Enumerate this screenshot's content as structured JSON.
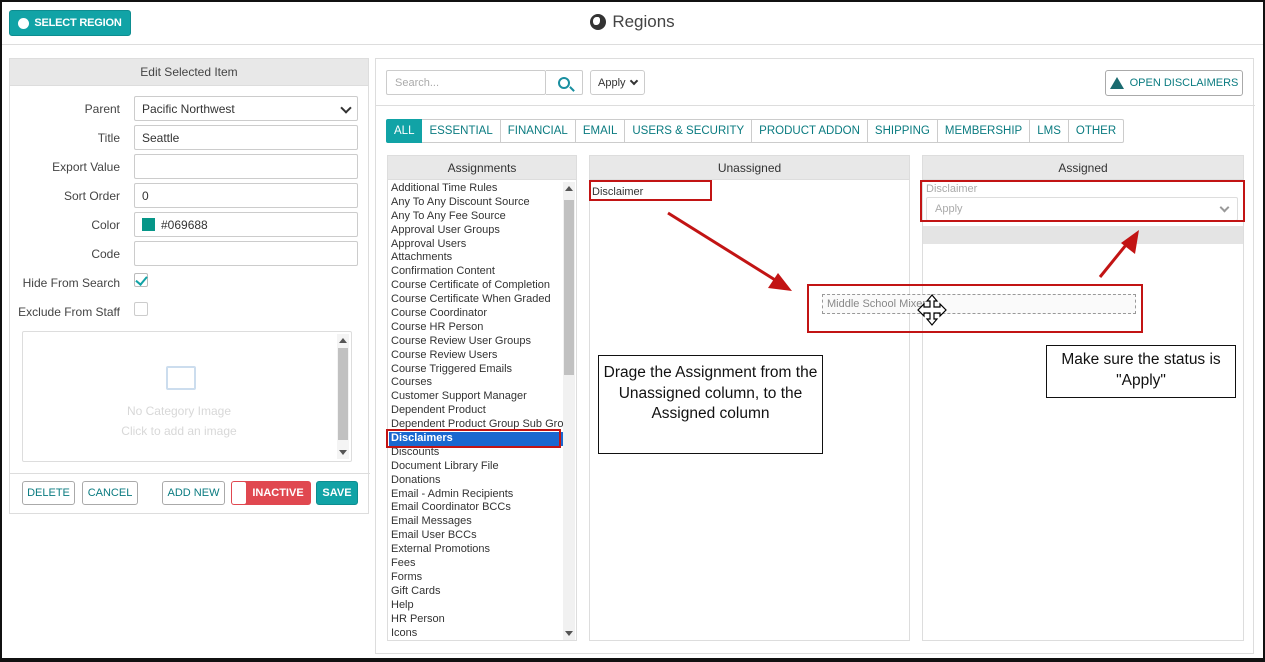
{
  "header": {
    "select_region_label": "SELECT REGION",
    "title": "Regions"
  },
  "edit_panel": {
    "title": "Edit Selected Item",
    "fields": {
      "parent": {
        "label": "Parent",
        "value": "Pacific Northwest"
      },
      "title": {
        "label": "Title",
        "value": "Seattle"
      },
      "export_value": {
        "label": "Export Value",
        "value": ""
      },
      "sort_order": {
        "label": "Sort Order",
        "value": "0"
      },
      "color": {
        "label": "Color",
        "value": "#069688",
        "swatch": "#069688"
      },
      "code": {
        "label": "Code",
        "value": ""
      },
      "hide_from_search": {
        "label": "Hide From Search",
        "checked": true
      },
      "exclude_from_staff": {
        "label": "Exclude From Staff",
        "checked": false
      }
    },
    "image": {
      "line1": "No Category Image",
      "line2": "Click to add an image"
    },
    "buttons": {
      "delete": "DELETE",
      "cancel": "CANCEL",
      "add_new": "ADD NEW",
      "inactive": "INACTIVE",
      "save": "SAVE"
    }
  },
  "toolbar": {
    "search_placeholder": "Search...",
    "apply_select": "Apply",
    "open_disclaimers": "OPEN DISCLAIMERS"
  },
  "tabs": [
    "ALL",
    "ESSENTIAL",
    "FINANCIAL",
    "EMAIL",
    "USERS & SECURITY",
    "PRODUCT ADDON",
    "SHIPPING",
    "MEMBERSHIP",
    "LMS",
    "OTHER"
  ],
  "columns": {
    "assignments": {
      "title": "Assignments",
      "items": [
        "Additional Time Rules",
        "Any To Any Discount Source",
        "Any To Any Fee Source",
        "Approval User Groups",
        "Approval Users",
        "Attachments",
        "Confirmation Content",
        "Course Certificate of Completion",
        "Course Certificate When Graded",
        "Course Coordinator",
        "Course HR Person",
        "Course Review User Groups",
        "Course Review Users",
        "Course Triggered Emails",
        "Courses",
        "Customer Support Manager",
        "Dependent Product",
        "Dependent Product Group Sub Group",
        "Disclaimers",
        "Discounts",
        "Document Library File",
        "Donations",
        "Email - Admin Recipients",
        "Email Coordinator BCCs",
        "Email Messages",
        "Email User BCCs",
        "External Promotions",
        "Fees",
        "Forms",
        "Gift Cards",
        "Help",
        "HR Person",
        "Icons"
      ],
      "selected": "Disclaimers"
    },
    "unassigned": {
      "title": "Unassigned",
      "item": "Disclaimer"
    },
    "assigned": {
      "title": "Assigned",
      "item_label": "Disclaimer",
      "status": "Apply"
    }
  },
  "drag_item": "Middle School Mixer",
  "annotations": {
    "callout_left": "Drage the Assignment from the Unassigned column, to the Assigned column",
    "callout_right": "Make sure the status is \"Apply\""
  },
  "colors": {
    "accent": "#11a3a6",
    "inactive": "#e04850",
    "highlight": "#c21414",
    "selected_row": "#1a68d0"
  }
}
